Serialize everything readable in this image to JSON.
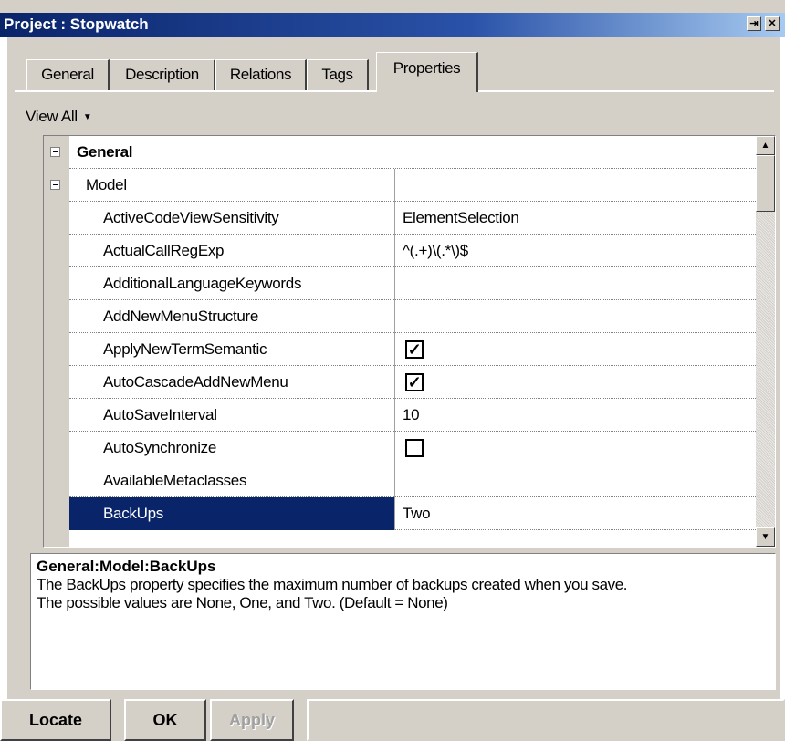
{
  "window": {
    "title": "Project : Stopwatch",
    "pin_icon": "pin-icon",
    "close_icon": "close-icon"
  },
  "tabs": [
    {
      "label": "General",
      "active": false
    },
    {
      "label": "Description",
      "active": false
    },
    {
      "label": "Relations",
      "active": false
    },
    {
      "label": "Tags",
      "active": false
    },
    {
      "label": "Properties",
      "active": true
    }
  ],
  "view_filter": {
    "label": "View All"
  },
  "grid": {
    "section": "General",
    "group": "Model",
    "rows": [
      {
        "name": "ActiveCodeViewSensitivity",
        "value": "ElementSelection",
        "type": "text"
      },
      {
        "name": "ActualCallRegExp",
        "value": "^(.+)\\(.*\\)$",
        "type": "text"
      },
      {
        "name": "AdditionalLanguageKeywords",
        "value": "",
        "type": "text"
      },
      {
        "name": "AddNewMenuStructure",
        "value": "",
        "type": "text"
      },
      {
        "name": "ApplyNewTermSemantic",
        "value": "✓",
        "type": "checkbox",
        "checked": true
      },
      {
        "name": "AutoCascadeAddNewMenu",
        "value": "✓",
        "type": "checkbox",
        "checked": true
      },
      {
        "name": "AutoSaveInterval",
        "value": "10",
        "type": "text"
      },
      {
        "name": "AutoSynchronize",
        "value": "",
        "type": "checkbox",
        "checked": false
      },
      {
        "name": "AvailableMetaclasses",
        "value": "",
        "type": "text"
      },
      {
        "name": "BackUps",
        "value": "Two",
        "type": "text",
        "selected": true
      }
    ]
  },
  "description": {
    "title": "General:Model:BackUps",
    "line1": "The BackUps property specifies the maximum number of backups created when you save.",
    "line2": "The possible values are None, One, and Two. (Default = None)"
  },
  "buttons": {
    "locate": "Locate",
    "ok": "OK",
    "apply": "Apply"
  },
  "colors": {
    "selection": "#0a246a",
    "title_bar": "#0a246a",
    "face": "#d4d0c8"
  }
}
